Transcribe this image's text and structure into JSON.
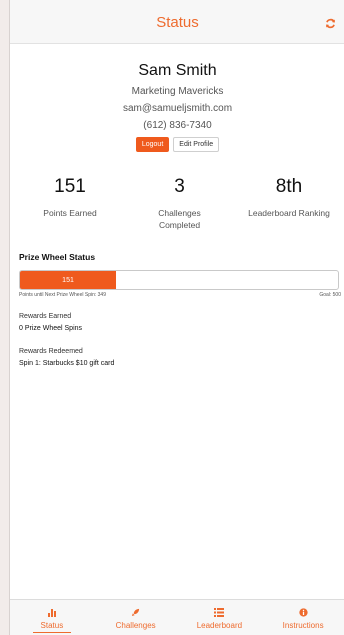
{
  "header": {
    "title": "Status"
  },
  "profile": {
    "name": "Sam Smith",
    "team": "Marketing Mavericks",
    "email": "sam@samueljsmith.com",
    "phone": "(612) 836-7340",
    "logout_label": "Logout",
    "edit_label": "Edit Profile"
  },
  "stats": [
    {
      "value": "151",
      "label": "Points Earned"
    },
    {
      "value": "3",
      "label": "Challenges Completed"
    },
    {
      "value": "8th",
      "label": "Leaderboard Ranking"
    }
  ],
  "prize_wheel": {
    "title": "Prize Wheel Status",
    "points": "151",
    "progress": 0.302,
    "until_text": "Points until Next Prize Wheel Spin: 349",
    "goal_text": "Goal: 500"
  },
  "rewards_earned": {
    "label": "Rewards Earned",
    "value": "0 Prize Wheel Spins"
  },
  "rewards_redeemed": {
    "label": "Rewards Redeemed",
    "value": "Spin 1: Starbucks $10 gift card"
  },
  "tabs": [
    {
      "label": "Status",
      "icon": "bar-chart-icon",
      "active": true
    },
    {
      "label": "Challenges",
      "icon": "rocket-icon",
      "active": false
    },
    {
      "label": "Leaderboard",
      "icon": "list-icon",
      "active": false
    },
    {
      "label": "Instructions",
      "icon": "info-icon",
      "active": false
    }
  ],
  "colors": {
    "accent": "#ef5a1d",
    "header_bg": "#f7f7f7"
  }
}
